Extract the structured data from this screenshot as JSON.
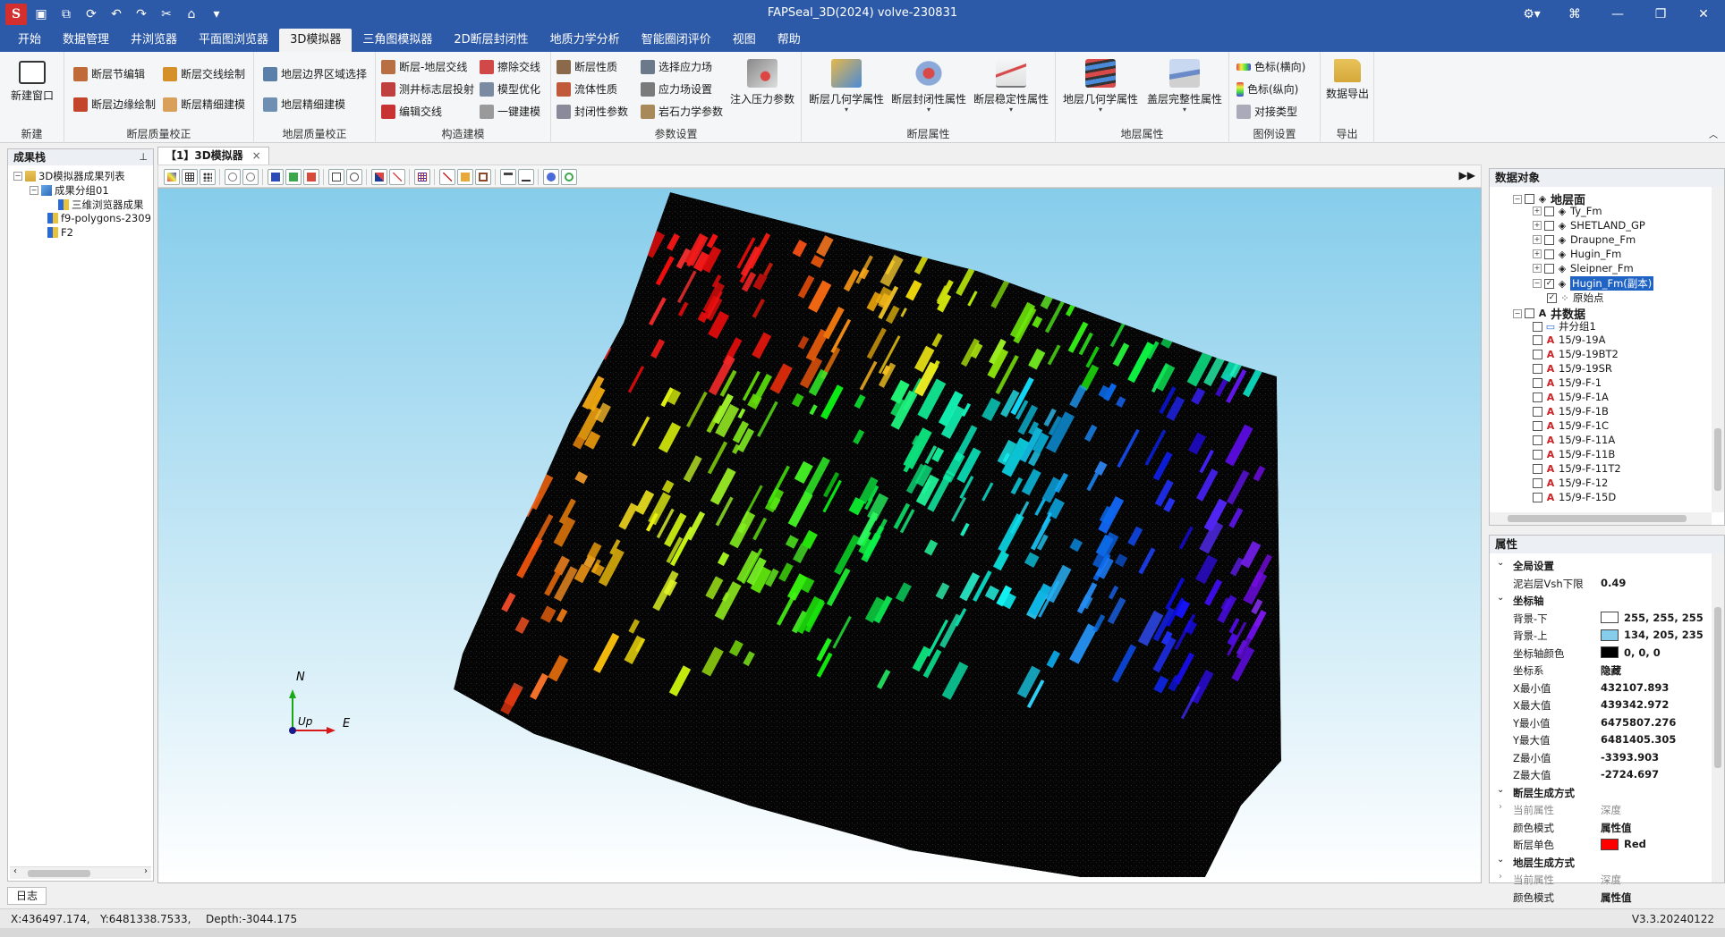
{
  "titlebar": {
    "title": "FAPSeal_3D(2024) volve-230831",
    "logo_text": "S",
    "quick_access_icons": [
      "save-icon",
      "save-as-icon",
      "refresh-icon",
      "undo-icon",
      "redo-icon",
      "cut-icon",
      "home-icon",
      "dropdown-icon"
    ],
    "window_controls": [
      "network-settings-icon",
      "pin-icon",
      "minimize-icon",
      "restore-icon",
      "close-icon"
    ]
  },
  "menu": {
    "tabs": [
      "开始",
      "数据管理",
      "井浏览器",
      "平面图浏览器",
      "3D模拟器",
      "三角图模拟器",
      "2D断层封闭性",
      "地质力学分析",
      "智能圈闭评价",
      "视图",
      "帮助"
    ],
    "active_index": 4
  },
  "ribbon": {
    "groups": [
      {
        "name": "新建",
        "items": [
          "新建窗口"
        ]
      },
      {
        "name": "断层质量校正",
        "items": [
          "断层节编辑",
          "断层交线绘制",
          "断层边缘绘制",
          "断层精细建模"
        ]
      },
      {
        "name": "地层质量校正",
        "items": [
          "地层边界区域选择",
          "地层精细建模"
        ]
      },
      {
        "name": "构造建模",
        "items": [
          "断层-地层交线",
          "擦除交线",
          "测井标志层投射",
          "模型优化",
          "编辑交线",
          "一键建模"
        ]
      },
      {
        "name": "参数设置",
        "items": [
          "断层性质",
          "选择应力场",
          "流体性质",
          "应力场设置",
          "封闭性参数",
          "岩石力学参数",
          "注入压力参数"
        ]
      },
      {
        "name": "断层属性",
        "items": [
          "断层几何学属性",
          "断层封闭性属性",
          "断层稳定性属性"
        ]
      },
      {
        "name": "地层属性",
        "items": [
          "地层几何学属性",
          "盖层完整性属性"
        ]
      },
      {
        "name": "图例设置",
        "items": [
          "色标(横向)",
          "色标(纵向)",
          "对接类型"
        ]
      },
      {
        "name": "导出",
        "items": [
          "数据导出"
        ]
      }
    ]
  },
  "left_panel": {
    "title": "成果栈",
    "pin": "⊥",
    "tree": [
      {
        "label": "3D模拟器成果列表",
        "level": 0
      },
      {
        "label": "成果分组01",
        "level": 1
      },
      {
        "label": "三维浏览器成果",
        "level": 2
      },
      {
        "label": "f9-polygons-2309",
        "level": 1
      },
      {
        "label": "F2",
        "level": 1
      }
    ]
  },
  "document": {
    "tab_label": "【1】3D模拟器",
    "tab_close": "×",
    "toolbar_tools": [
      "color-bar-icon",
      "grid-icon",
      "points-icon",
      "zoom-in-icon",
      "zoom-out-icon",
      "cube-view-icon",
      "cube-green-icon",
      "cube-red-icon",
      "copy-view-icon",
      "hide-icon",
      "axis-icon",
      "measure-icon",
      "mesh-icon",
      "pen-icon",
      "color-icon",
      "frame-icon",
      "filter-icon",
      "text-icon",
      "screenshot-icon",
      "reset-icon"
    ],
    "expand_glyph": "▶▶",
    "axes": {
      "north": "N",
      "up": "Up",
      "east": "E"
    },
    "colors": {
      "background_bottom": "#ffffff",
      "background_top": "#86cdeb",
      "axis": "#000000"
    }
  },
  "object_panel": {
    "title": "数据对象",
    "rows": [
      {
        "label": "地层面",
        "level": 0,
        "bold": true,
        "exp": "−",
        "checked": false
      },
      {
        "label": "Ty_Fm",
        "level": 1,
        "exp": "+",
        "checked": false
      },
      {
        "label": "SHETLAND_GP",
        "level": 1,
        "exp": "+",
        "checked": false
      },
      {
        "label": "Draupne_Fm",
        "level": 1,
        "exp": "+",
        "checked": false
      },
      {
        "label": "Hugin_Fm",
        "level": 1,
        "exp": "+",
        "checked": false
      },
      {
        "label": "Sleipner_Fm",
        "level": 1,
        "exp": "+",
        "checked": false
      },
      {
        "label": "Hugin_Fm(副本)",
        "level": 1,
        "exp": "−",
        "checked": true,
        "selected": true
      },
      {
        "label": "原始点",
        "level": 2,
        "checked": true
      },
      {
        "label": "井数据",
        "level": 0,
        "bold": true,
        "exp": "−",
        "checked": false
      },
      {
        "label": "井分组1",
        "level": 1,
        "checked": false
      },
      {
        "label": "15/9-19A",
        "level": 1,
        "checked": false
      },
      {
        "label": "15/9-19BT2",
        "level": 1,
        "checked": false
      },
      {
        "label": "15/9-19SR",
        "level": 1,
        "checked": false
      },
      {
        "label": "15/9-F-1",
        "level": 1,
        "checked": false
      },
      {
        "label": "15/9-F-1A",
        "level": 1,
        "checked": false
      },
      {
        "label": "15/9-F-1B",
        "level": 1,
        "checked": false
      },
      {
        "label": "15/9-F-1C",
        "level": 1,
        "checked": false
      },
      {
        "label": "15/9-F-11A",
        "level": 1,
        "checked": false
      },
      {
        "label": "15/9-F-11B",
        "level": 1,
        "checked": false
      },
      {
        "label": "15/9-F-11T2",
        "level": 1,
        "checked": false
      },
      {
        "label": "15/9-F-12",
        "level": 1,
        "checked": false
      },
      {
        "label": "15/9-F-15D",
        "level": 1,
        "checked": false
      }
    ]
  },
  "properties": {
    "title": "属性",
    "rows": [
      {
        "type": "section",
        "key": "全局设置"
      },
      {
        "key": "泥岩层Vsh下限",
        "value": "0.49"
      },
      {
        "type": "section",
        "key": "坐标轴"
      },
      {
        "key": "背景-下",
        "value": "255, 255, 255",
        "swatch": "#ffffff"
      },
      {
        "key": "背景-上",
        "value": "134, 205, 235",
        "swatch": "#86cdeb"
      },
      {
        "key": "坐标轴颜色",
        "value": "0, 0, 0",
        "swatch": "#000000"
      },
      {
        "key": "坐标系",
        "value": "隐藏"
      },
      {
        "key": "X最小值",
        "value": "432107.893"
      },
      {
        "key": "X最大值",
        "value": "439342.972"
      },
      {
        "key": "Y最小值",
        "value": "6475807.276"
      },
      {
        "key": "Y最大值",
        "value": "6481405.305"
      },
      {
        "key": "Z最小值",
        "value": "-3393.903"
      },
      {
        "key": "Z最大值",
        "value": "-2724.697"
      },
      {
        "type": "section",
        "key": "断层生成方式"
      },
      {
        "key": "当前属性",
        "value": "深度",
        "dim": true
      },
      {
        "key": "颜色模式",
        "value": "属性值"
      },
      {
        "key": "断层单色",
        "value": "Red",
        "swatch": "#ff0000"
      },
      {
        "type": "section",
        "key": "地层生成方式"
      },
      {
        "key": "当前属性",
        "value": "深度",
        "dim": true
      },
      {
        "key": "颜色模式",
        "value": "属性值"
      }
    ]
  },
  "bottom": {
    "log_tab": "日志",
    "status_x": "X:436497.174,",
    "status_y": "Y:6481338.7533,",
    "status_depth": "Depth:-3044.175",
    "version": "V3.3.20240122"
  }
}
